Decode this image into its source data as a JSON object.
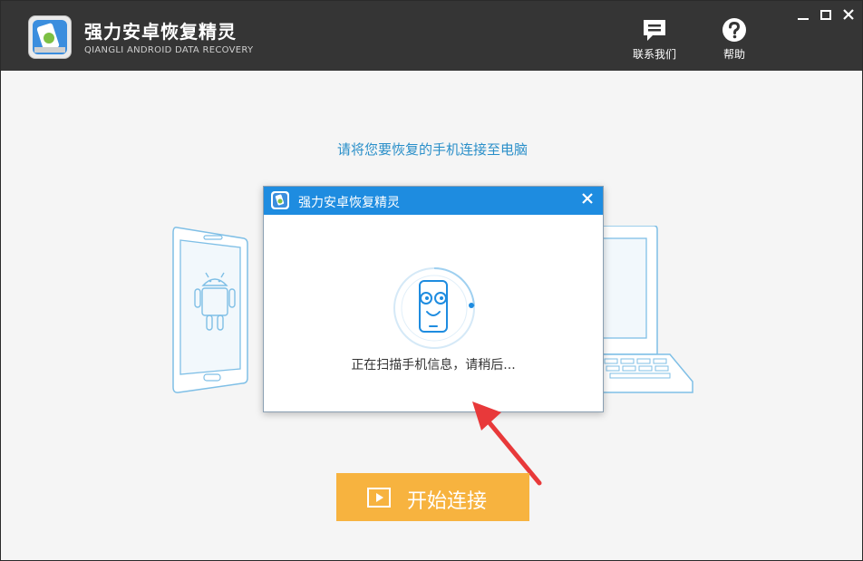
{
  "app": {
    "title": "强力安卓恢复精灵",
    "subtitle": "QIANGLI ANDROID DATA RECOVERY"
  },
  "header_actions": {
    "contact_label": "联系我们",
    "help_label": "帮助"
  },
  "main": {
    "instruction": "请将您要恢复的手机连接至电脑",
    "start_button_label": "开始连接"
  },
  "dialog": {
    "title": "强力安卓恢复精灵",
    "status_text": "正在扫描手机信息，请稍后..."
  },
  "colors": {
    "titlebar": "#353535",
    "accent_blue": "#1e8ce0",
    "instruction_blue": "#2a8fc9",
    "start_button": "#f7b33f",
    "annotation_arrow": "#e8393a"
  },
  "icons": [
    "app-logo-icon",
    "chat-icon",
    "help-icon",
    "minimize-icon",
    "maximize-icon",
    "close-icon",
    "play-icon",
    "scanning-phone-icon"
  ]
}
